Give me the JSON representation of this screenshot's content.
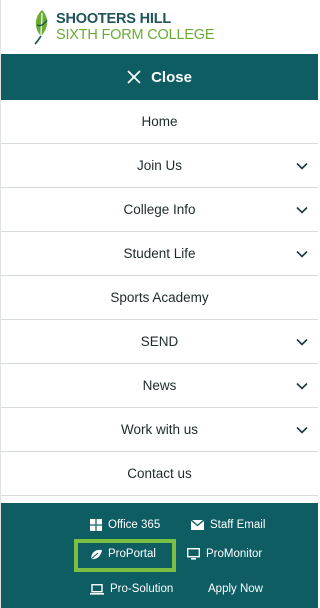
{
  "brand": {
    "name_line1": "SHOOTERS HILL",
    "name_line2": "SIXTH FORM COLLEGE",
    "logo_icon": "leaf-logo-icon",
    "primary_color": "#0d5d63",
    "accent_color": "#7ac043"
  },
  "close_button": {
    "label": "Close",
    "icon": "close-icon"
  },
  "menu": {
    "items": [
      {
        "label": "Home",
        "has_submenu": false
      },
      {
        "label": "Join Us",
        "has_submenu": true
      },
      {
        "label": "College Info",
        "has_submenu": true
      },
      {
        "label": "Student Life",
        "has_submenu": true
      },
      {
        "label": "Sports Academy",
        "has_submenu": false
      },
      {
        "label": "SEND",
        "has_submenu": true
      },
      {
        "label": "News",
        "has_submenu": true
      },
      {
        "label": "Work with us",
        "has_submenu": true
      },
      {
        "label": "Contact us",
        "has_submenu": false
      }
    ]
  },
  "footer": {
    "office365": {
      "label": "Office 365",
      "icon": "windows-icon"
    },
    "staff_email": {
      "label": "Staff Email",
      "icon": "envelope-icon"
    },
    "proportal": {
      "label": "ProPortal",
      "icon": "leaf-icon",
      "highlighted": true
    },
    "promonitor": {
      "label": "ProMonitor",
      "icon": "monitor-icon"
    },
    "prosolution": {
      "label": "Pro-Solution",
      "icon": "laptop-icon"
    },
    "apply_now": {
      "label": "Apply Now"
    }
  }
}
